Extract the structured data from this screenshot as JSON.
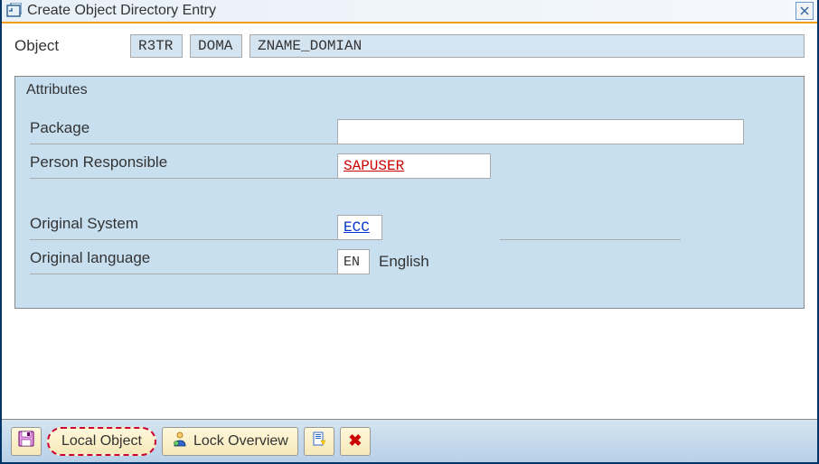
{
  "window": {
    "title": "Create Object Directory Entry"
  },
  "object": {
    "label": "Object",
    "type1": "R3TR",
    "type2": "DOMA",
    "name": "ZNAME_DOMIAN"
  },
  "attributes": {
    "tab_label": "Attributes",
    "package_label": "Package",
    "package_value": "",
    "person_label": "Person Responsible",
    "person_value": "SAPUSER",
    "system_label": "Original System",
    "system_value": "ECC",
    "language_label": "Original language",
    "language_code": "EN",
    "language_text": "English"
  },
  "buttons": {
    "local_object": "Local Object",
    "lock_overview": "Lock Overview"
  }
}
